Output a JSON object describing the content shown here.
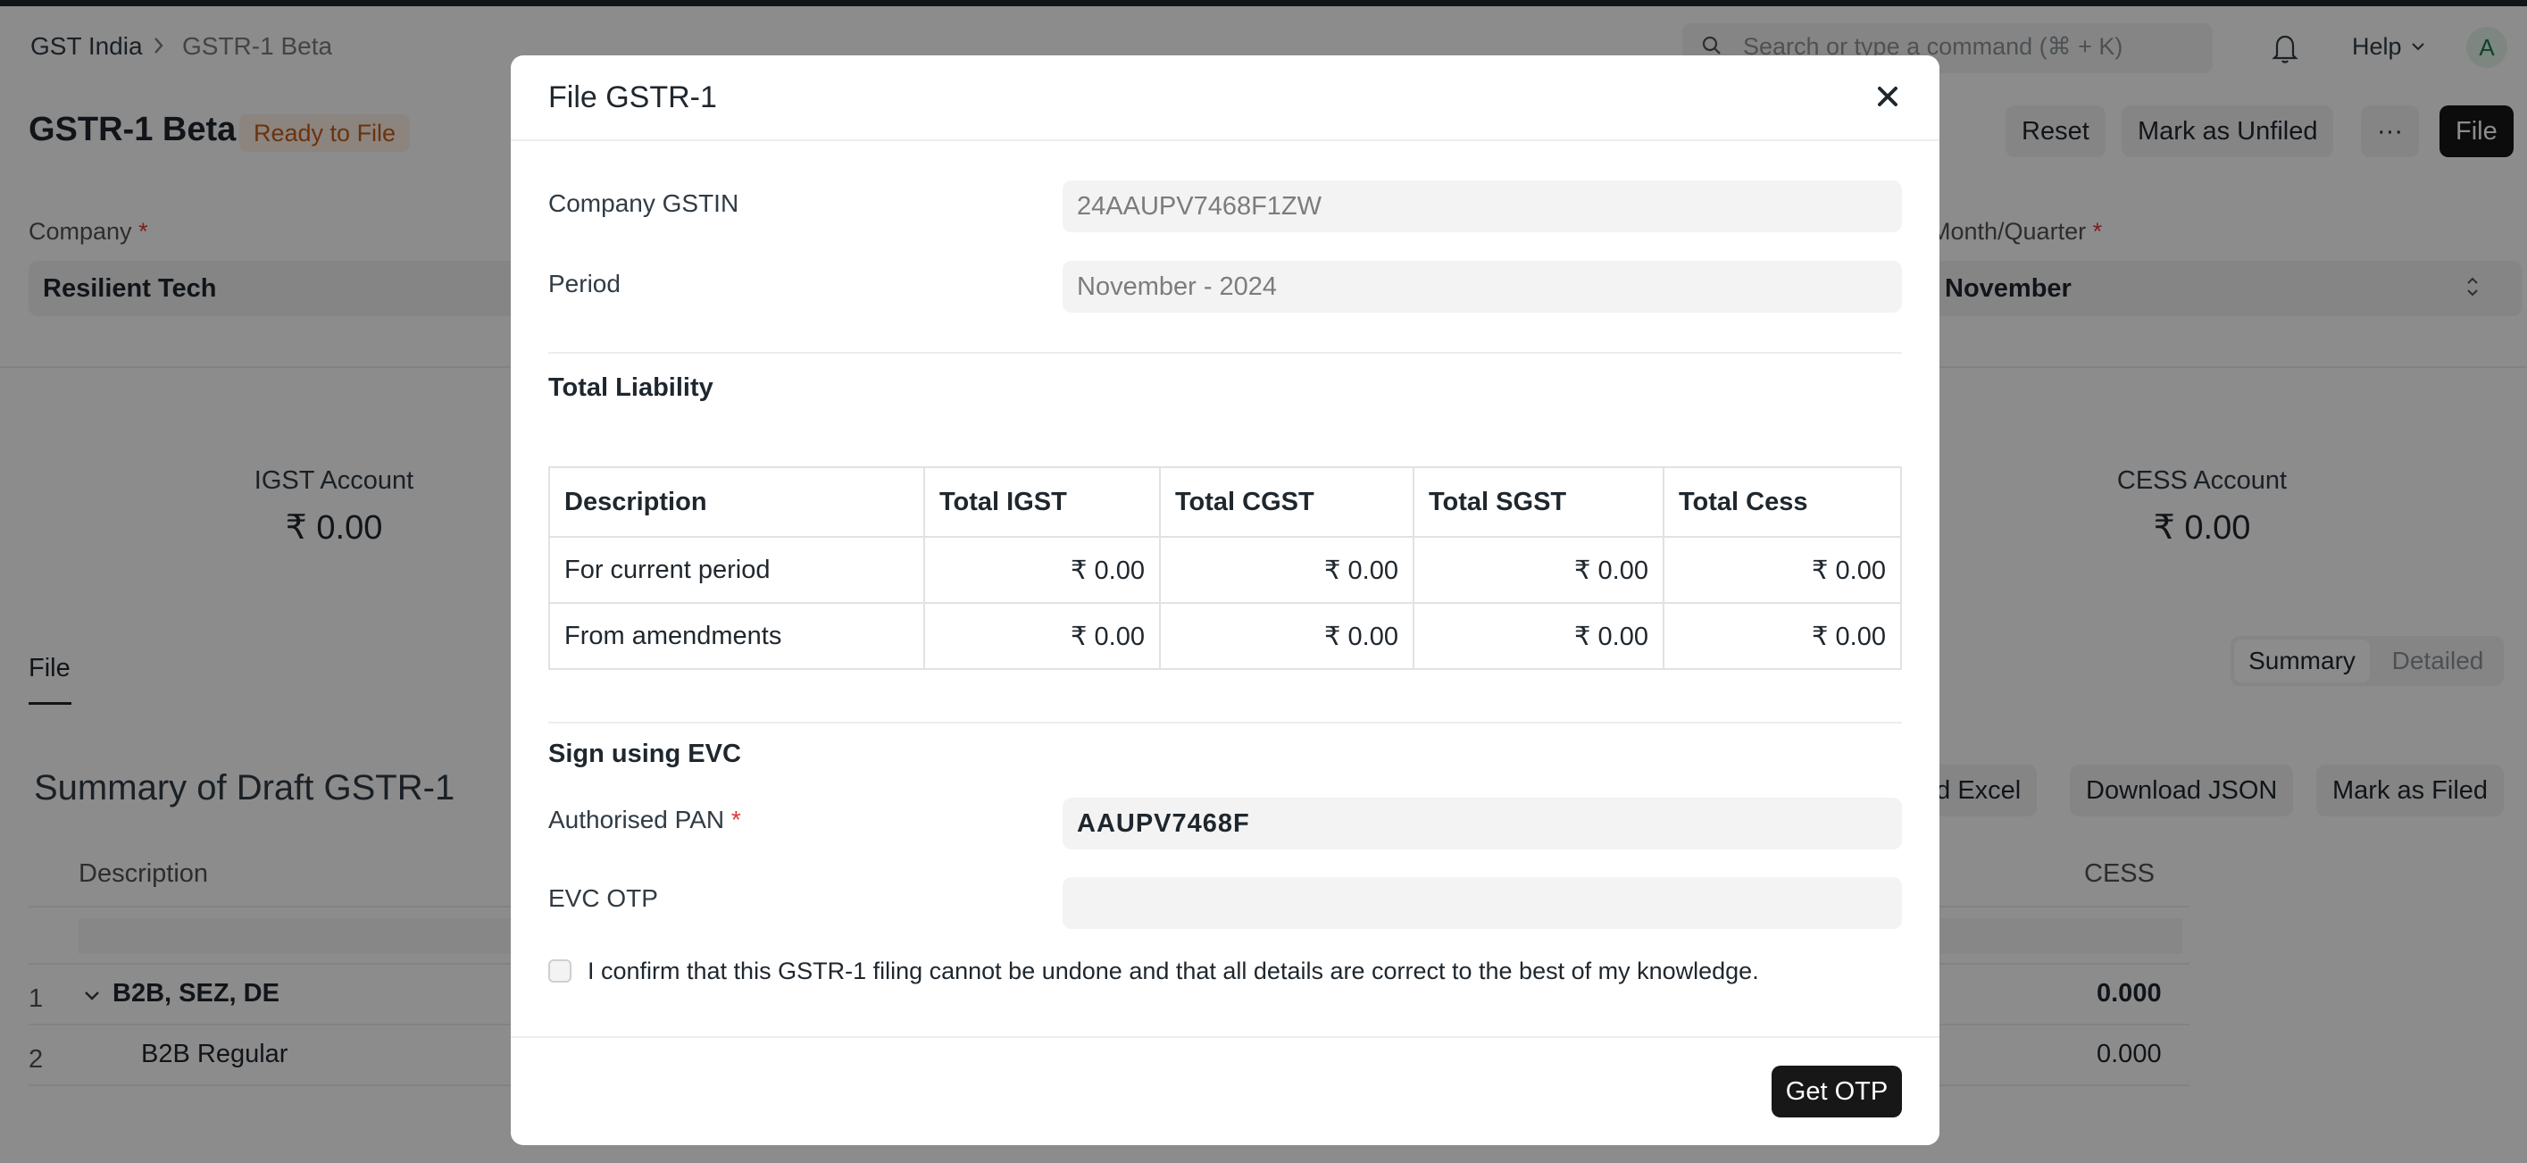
{
  "breadcrumb": {
    "root": "GST India",
    "current": "GSTR-1 Beta"
  },
  "search": {
    "placeholder": "Search or type a command (⌘ + K)"
  },
  "navbar": {
    "help_label": "Help",
    "avatar_initial": "A"
  },
  "page": {
    "title": "GSTR-1 Beta",
    "status": "Ready to File",
    "actions": {
      "reset": "Reset",
      "mark_unfiled": "Mark as Unfiled",
      "more": "···",
      "file": "File"
    }
  },
  "filters": {
    "company_label": "Company",
    "company_value": "Resilient Tech",
    "period_label": "Month/Quarter",
    "period_value": "November",
    "required_mark": "*"
  },
  "accounts": {
    "igst_label": "IGST Account",
    "igst_value": "₹ 0.00",
    "cess_label": "CESS Account",
    "cess_value": "₹ 0.00"
  },
  "tabs": {
    "file": "File"
  },
  "view_toggle": {
    "summary": "Summary",
    "detailed": "Detailed"
  },
  "summary": {
    "title": "Summary of Draft GSTR-1",
    "actions": {
      "download_excel": "ad Excel",
      "download_json": "Download JSON",
      "mark_filed": "Mark as Filed"
    },
    "columns": {
      "description": "Description",
      "cess": "CESS"
    },
    "rows": [
      {
        "num": "1",
        "label": "B2B, SEZ, DE",
        "cess": "0.000"
      },
      {
        "num": "2",
        "label": "B2B Regular",
        "cess": "0.000"
      }
    ]
  },
  "modal": {
    "title": "File GSTR-1",
    "gstin_label": "Company GSTIN",
    "gstin_value": "24AAUPV7468F1ZW",
    "period_label": "Period",
    "period_value": "November - 2024",
    "liability_title": "Total Liability",
    "liability_table": {
      "headers": [
        "Description",
        "Total IGST",
        "Total CGST",
        "Total SGST",
        "Total Cess"
      ],
      "rows": [
        [
          "For current period",
          "₹ 0.00",
          "₹ 0.00",
          "₹ 0.00",
          "₹ 0.00"
        ],
        [
          "From amendments",
          "₹ 0.00",
          "₹ 0.00",
          "₹ 0.00",
          "₹ 0.00"
        ]
      ]
    },
    "evc_title": "Sign using EVC",
    "pan_label": "Authorised PAN",
    "pan_value": "AAUPV7468F",
    "otp_label": "EVC OTP",
    "otp_value": "",
    "confirm_text": "I confirm that this GSTR-1 filing cannot be undone and that all details are correct to the best of my knowledge.",
    "get_otp_button": "Get OTP"
  },
  "colors": {
    "primary_dark": "#171717",
    "status_orange": "#c25d19",
    "required_red": "#e03636",
    "overlay": "rgba(0,0,0,0.45)"
  }
}
